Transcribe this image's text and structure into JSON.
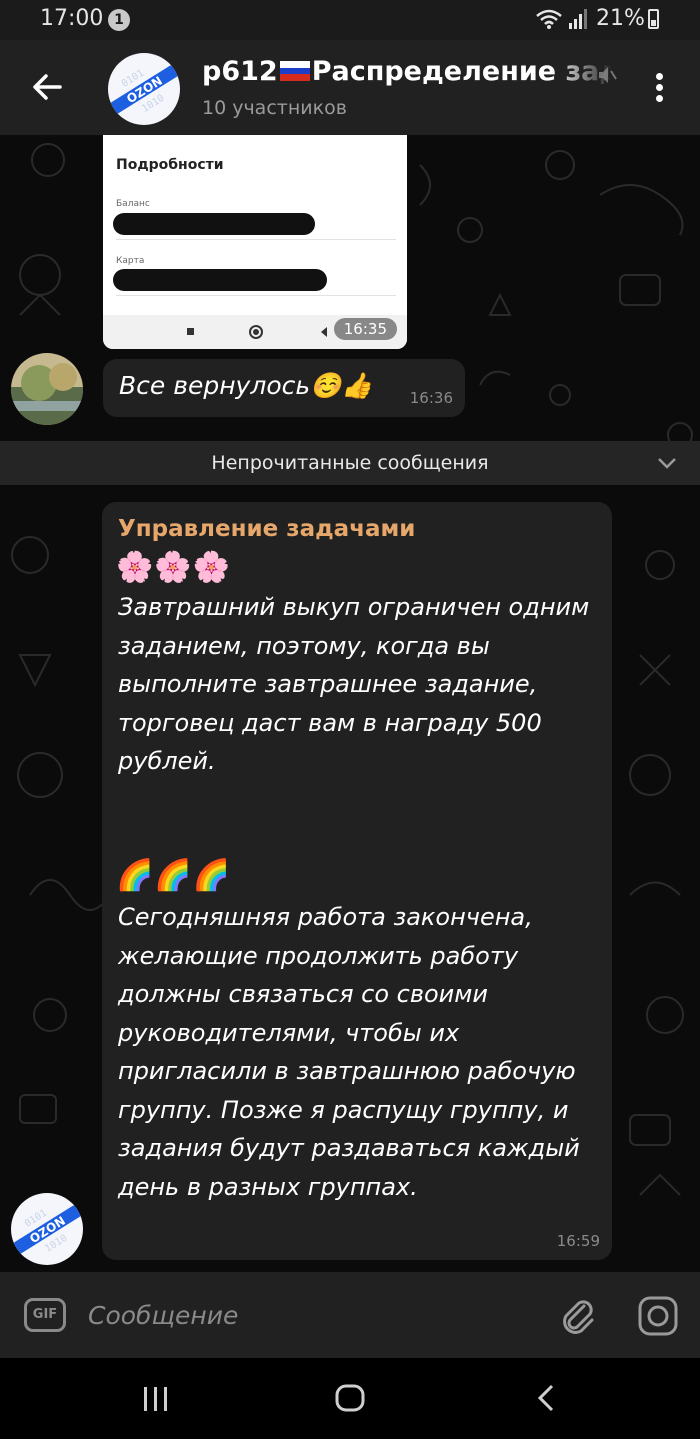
{
  "status_bar": {
    "time": "17:00",
    "notification_count": "1",
    "battery_percent": "21%",
    "battery_level": 0.21
  },
  "header": {
    "title_prefix": "p612",
    "title_suffix": "Распределение зад",
    "flag_icon": "russia-flag-icon",
    "members": "10 участников"
  },
  "messages": {
    "image": {
      "title": "Подробности",
      "label_balance": "Баланс",
      "label_card": "Карта",
      "time": "16:35"
    },
    "reply": {
      "text": "Все вернулось☺️👍",
      "time": "16:36"
    },
    "unread_divider": "Непрочитанные сообщения",
    "announcement": {
      "sender": "Управление задачами",
      "emojis_1": "🌸🌸🌸",
      "paragraph_1": "Завтрашний выкуп ограничен одним заданием, поэтому, когда вы выполните завтрашнее задание, торговец даст вам в награду 500 рублей.",
      "emojis_2": "🌈🌈🌈",
      "paragraph_2": "Сегодняшняя работа закончена, желающие продолжить работу должны связаться со своими руководителями, чтобы их пригласили в завтрашнюю рабочую группу. Позже я распущу группу, и задания будут раздаваться каждый день в разных группах.",
      "time": "16:59"
    }
  },
  "composer": {
    "gif_label": "GIF",
    "placeholder": "Сообщение"
  },
  "colors": {
    "header_bg": "#212121",
    "bubble_bg": "#212121",
    "sender_name": "#e7a76b",
    "ozon_blue": "#1d5fe0"
  }
}
